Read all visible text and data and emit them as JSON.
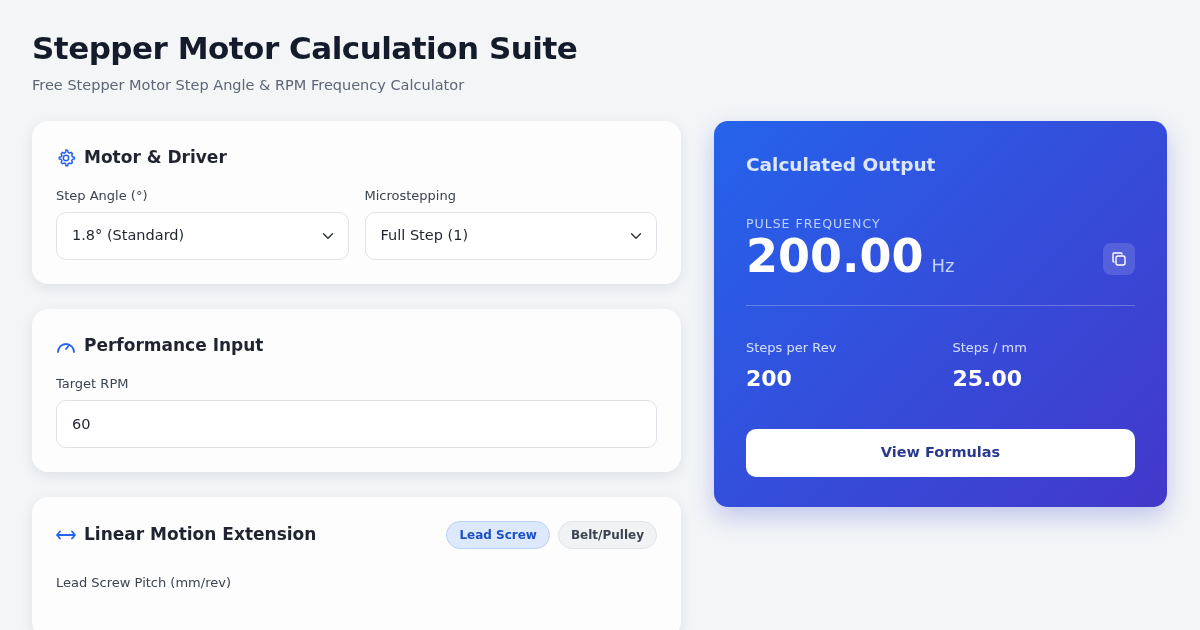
{
  "header": {
    "title": "Stepper Motor Calculation Suite",
    "subtitle": "Free Stepper Motor Step Angle & RPM Frequency Calculator"
  },
  "motor_driver": {
    "title": "Motor & Driver",
    "fields": [
      {
        "label": "Step Angle (°)",
        "value": "1.8° (Standard)"
      },
      {
        "label": "Microstepping",
        "value": "Full Step (1)"
      }
    ]
  },
  "performance": {
    "title": "Performance Input",
    "field": {
      "label": "Target RPM",
      "value": "60"
    }
  },
  "linear_motion": {
    "title": "Linear Motion Extension",
    "modes": [
      {
        "label": "Lead Screw",
        "selected": true
      },
      {
        "label": "Belt/Pulley",
        "selected": false
      }
    ],
    "field_label": "Lead Screw Pitch (mm/rev)"
  },
  "output": {
    "title": "Calculated Output",
    "primary": {
      "label": "PULSE FREQUENCY",
      "value": "200.00",
      "unit": "Hz"
    },
    "stats": [
      {
        "label": "Steps per Rev",
        "value": "200"
      },
      {
        "label": "Steps / mm",
        "value": "25.00"
      }
    ],
    "button": "View Formulas"
  }
}
